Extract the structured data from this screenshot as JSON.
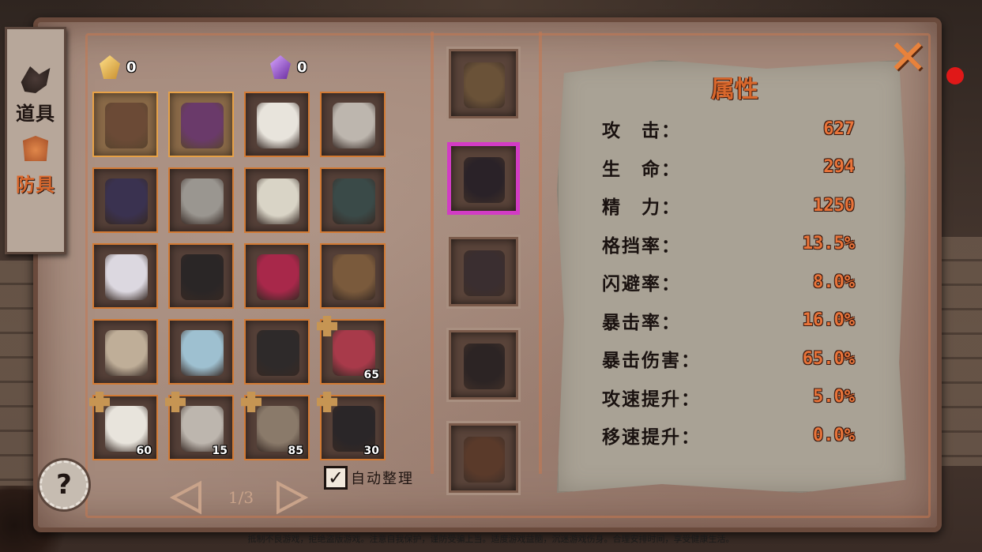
{
  "tabs": [
    {
      "label": "道具",
      "icon": "items-icon",
      "active": false
    },
    {
      "label": "防具",
      "icon": "armor-icon",
      "active": true
    }
  ],
  "currency": [
    {
      "icon": "gold-crystal-icon",
      "value": "0"
    },
    {
      "icon": "purple-crystal-icon",
      "value": "0"
    }
  ],
  "inventory": [
    {
      "icon": "flaming-pauldron-icon",
      "count": "",
      "fragment": false,
      "selected": true,
      "color": "#6b4a36"
    },
    {
      "icon": "purple-horned-crown-icon",
      "count": "",
      "fragment": false,
      "selected": true,
      "color": "#6a3a6a"
    },
    {
      "icon": "white-gold-robe-icon",
      "count": "",
      "fragment": false,
      "selected": false,
      "color": "#e8e4dc"
    },
    {
      "icon": "bandaged-vest-icon",
      "count": "",
      "fragment": false,
      "selected": false,
      "color": "#bdb6ae"
    },
    {
      "icon": "purple-hooded-shirt-icon",
      "count": "",
      "fragment": false,
      "selected": false,
      "color": "#3a3250"
    },
    {
      "icon": "skull-helm-icon",
      "count": "",
      "fragment": false,
      "selected": false,
      "color": "#9a9690"
    },
    {
      "icon": "silver-crown-icon",
      "count": "",
      "fragment": false,
      "selected": false,
      "color": "#d9d4c6"
    },
    {
      "icon": "eye-mask-icon",
      "count": "",
      "fragment": false,
      "selected": false,
      "color": "#3a4a48"
    },
    {
      "icon": "white-mask-icon",
      "count": "",
      "fragment": false,
      "selected": false,
      "color": "#dcd8e0"
    },
    {
      "icon": "dark-gold-helm-icon",
      "count": "",
      "fragment": false,
      "selected": false,
      "color": "#2a2626"
    },
    {
      "icon": "red-boots-icon",
      "count": "",
      "fragment": false,
      "selected": false,
      "color": "#a8284a"
    },
    {
      "icon": "clawed-gauntlets-icon",
      "count": "",
      "fragment": false,
      "selected": false,
      "color": "#7a5a3c"
    },
    {
      "icon": "wrapped-boots-icon",
      "count": "",
      "fragment": false,
      "selected": false,
      "color": "#bfae98"
    },
    {
      "icon": "crystal-greaves-icon",
      "count": "",
      "fragment": false,
      "selected": false,
      "color": "#9ec0d0"
    },
    {
      "icon": "spiked-boots-icon",
      "count": "",
      "fragment": false,
      "selected": false,
      "color": "#2e2a2a"
    },
    {
      "icon": "red-armor-icon",
      "count": "65",
      "fragment": true,
      "selected": false,
      "color": "#a83a4a"
    },
    {
      "icon": "white-gold-robe-icon",
      "count": "60",
      "fragment": true,
      "selected": false,
      "color": "#e8e4dc"
    },
    {
      "icon": "bandaged-vest-icon",
      "count": "15",
      "fragment": true,
      "selected": false,
      "color": "#bdb6ae"
    },
    {
      "icon": "bone-gloves-icon",
      "count": "85",
      "fragment": true,
      "selected": false,
      "color": "#8a7a6a"
    },
    {
      "icon": "black-pink-armor-icon",
      "count": "30",
      "fragment": true,
      "selected": false,
      "color": "#2a2628"
    }
  ],
  "pager": {
    "label": "1/3"
  },
  "auto_sort": {
    "label": "自动整理",
    "checked": true,
    "mark": "✓"
  },
  "help": {
    "label": "?"
  },
  "equipment": [
    {
      "icon": "flail-weapon-icon",
      "active": false,
      "color": "#6a5238"
    },
    {
      "icon": "dark-cloak-icon",
      "active": true,
      "color": "#2a2228"
    },
    {
      "icon": "witch-hat-icon",
      "active": false,
      "color": "#3a2e30"
    },
    {
      "icon": "red-eye-cloak-icon",
      "active": false,
      "color": "#2c2424"
    },
    {
      "icon": "red-gem-boots-icon",
      "active": false,
      "color": "#5a3a2a"
    }
  ],
  "stats": {
    "title": "属性",
    "rows": [
      {
        "label": "攻　击：",
        "value": "627"
      },
      {
        "label": "生　命：",
        "value": "294"
      },
      {
        "label": "精　力：",
        "value": "1250"
      },
      {
        "label": "格挡率：",
        "value": "13.5%"
      },
      {
        "label": "闪避率：",
        "value": "8.0%"
      },
      {
        "label": "暴击率：",
        "value": "16.0%"
      },
      {
        "label": "暴击伤害：",
        "value": "65.0%"
      },
      {
        "label": "攻速提升：",
        "value": "5.0%"
      },
      {
        "label": "移速提升：",
        "value": "0.0%"
      }
    ]
  },
  "close": {
    "label": "✕"
  },
  "notice": "抵制不良游戏，拒绝盗版游戏。注意自我保护，谨防受骗上当。适度游戏益脑，沉迷游戏伤身。合理安排时间，享受健康生活。"
}
